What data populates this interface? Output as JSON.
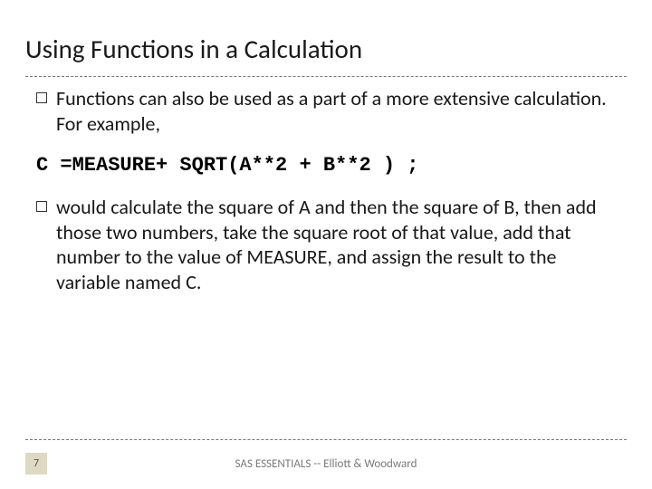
{
  "title": "Using Functions in a Calculation",
  "bullets": {
    "intro": "Functions can also be used as a part of a more extensive calculation. For example,",
    "explain": "would calculate the square of A and then the square of B, then add those two numbers, take the square root of that value, add that number to the value of MEASURE, and assign the result to the variable named C."
  },
  "code": "C =MEASURE+ SQRT(A**2 + B**2 ) ;",
  "footer": {
    "page": "7",
    "text": "SAS ESSENTIALS -- Elliott & Woodward"
  }
}
